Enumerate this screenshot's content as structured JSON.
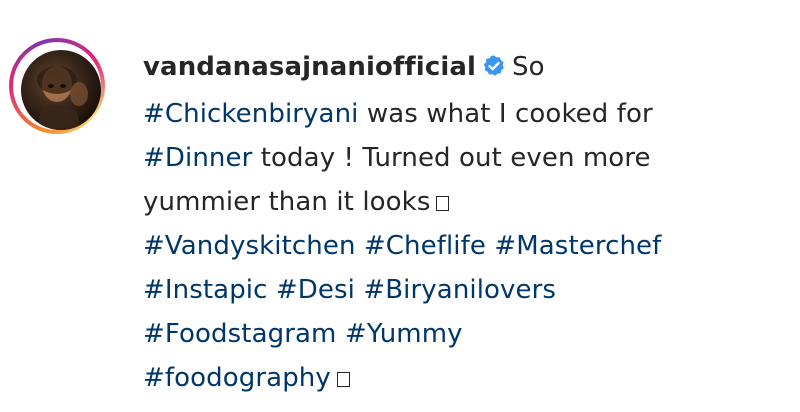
{
  "post": {
    "username": "vandanasajnaniofficial",
    "verified_icon": "verified-badge-icon",
    "accent_color": "#3897f0",
    "hashtag_color": "#00376b",
    "caption": {
      "intro": "So",
      "hashtag_chickenbiryani": "#Chickenbiryani",
      "text_1": "was what I cooked for",
      "hashtag_dinner": "#Dinner",
      "text_2": "today ! Turned out even more",
      "text_3": "yummier than it looks",
      "emoji_1": "missing-glyph-box",
      "hashtags": [
        "#Vandyskitchen",
        "#Cheflife",
        "#Masterchef",
        "#Instapic",
        "#Desi",
        "#Biryanilovers",
        "#Foodstagram",
        "#Yummy",
        "#foodography"
      ],
      "emoji_2": "missing-glyph-box"
    }
  }
}
